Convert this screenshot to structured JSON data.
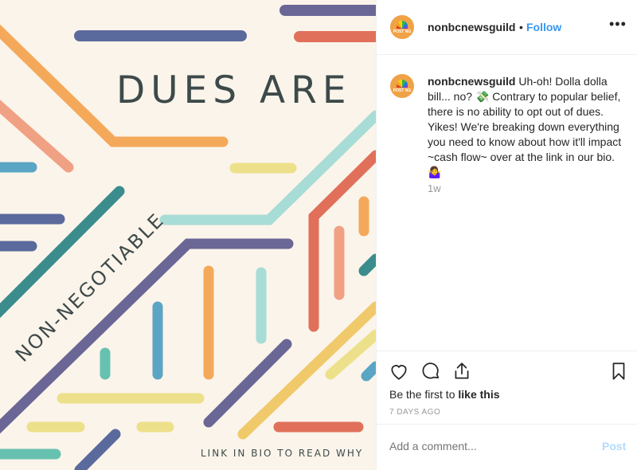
{
  "post_image": {
    "title": "DUES ARE",
    "subtitle": "NON-NEGOTIABLE",
    "footer": "LINK IN BIO TO READ WHY",
    "palette": {
      "background": "#fbf4ea",
      "orange": "#f4a95a",
      "salmon": "#f0a184",
      "navy": "#5b6a9c",
      "purple": "#6a6796",
      "teal": "#3b8c8c",
      "mint": "#a8dcd6",
      "yellow": "#ede08a",
      "red": "#e0705a",
      "blue": "#5aa5c4",
      "green": "#67c1b0"
    }
  },
  "header": {
    "avatar_icon": "nbc-peacock-logo",
    "avatar_text": "POST NG",
    "username": "nonbcnewsguild",
    "separator": "•",
    "follow_label": "Follow",
    "more_icon": "more-horizontal-icon",
    "more_label": "•••"
  },
  "caption": {
    "username": "nonbcnewsguild",
    "text_part1": " Uh-oh! Dolla dolla bill... no? ",
    "emoji1": "💸",
    "text_part2": " Contrary to popular belief, there is no ability to opt out of dues. Yikes! We're breaking down everything you need to know about how it'll impact ~cash flow~ over at the link in our bio. ",
    "emoji2": "🤷‍♀️",
    "time": "1w"
  },
  "actions": {
    "like_icon": "heart-icon",
    "comment_icon": "comment-icon",
    "share_icon": "share-icon",
    "save_icon": "bookmark-icon"
  },
  "likes": {
    "prefix": "Be the first to ",
    "link": "like this"
  },
  "timestamp": "7 DAYS AGO",
  "comment_box": {
    "placeholder": "Add a comment...",
    "post_label": "Post"
  }
}
